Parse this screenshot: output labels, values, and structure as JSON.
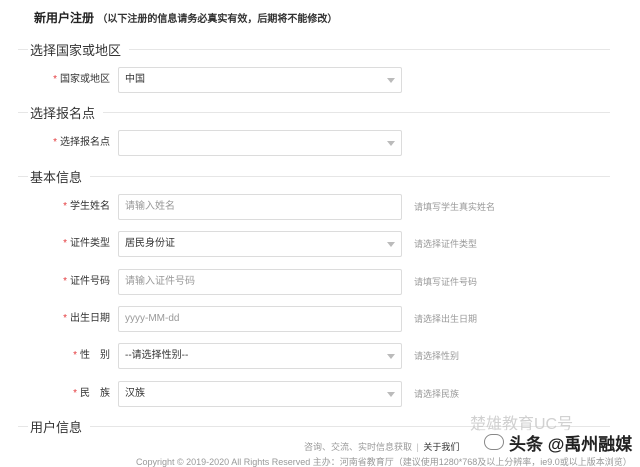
{
  "header": {
    "title": "新用户注册",
    "note": "（以下注册的信息请务必真实有效，后期将不能修改）"
  },
  "sections": {
    "country": "选择国家或地区",
    "signup_point": "选择报名点",
    "basic": "基本信息",
    "user": "用户信息"
  },
  "fields": {
    "country": {
      "label": "国家或地区",
      "value": "中国"
    },
    "signup_point": {
      "label": "选择报名点",
      "value": ""
    },
    "name": {
      "label": "学生姓名",
      "placeholder": "请输入姓名",
      "hint": "请填写学生真实姓名"
    },
    "id_type": {
      "label": "证件类型",
      "value": "居民身份证",
      "hint": "请选择证件类型"
    },
    "id_number": {
      "label": "证件号码",
      "placeholder": "请输入证件号码",
      "hint": "请填写证件号码"
    },
    "birth_date": {
      "label": "出生日期",
      "placeholder": "yyyy-MM-dd",
      "hint": "请选择出生日期"
    },
    "gender": {
      "label": "性　别",
      "value": "--请选择性别--",
      "hint": "请选择性别"
    },
    "ethnicity": {
      "label": "民　族",
      "value": "汉族",
      "hint": "请选择民族"
    }
  },
  "footer": {
    "links": [
      "咨询、交流、实时信息获取",
      "关于我们"
    ],
    "copyright": "Copyright © 2019-2020 All Rights Reserved 主办：河南省教育厅（建议使用1280*768及以上分辨率，ie9.0或以上版本浏览）"
  },
  "watermark": {
    "faded_text": "楚雄教育UC号",
    "tag_text": "头条 @禹州融媒"
  }
}
